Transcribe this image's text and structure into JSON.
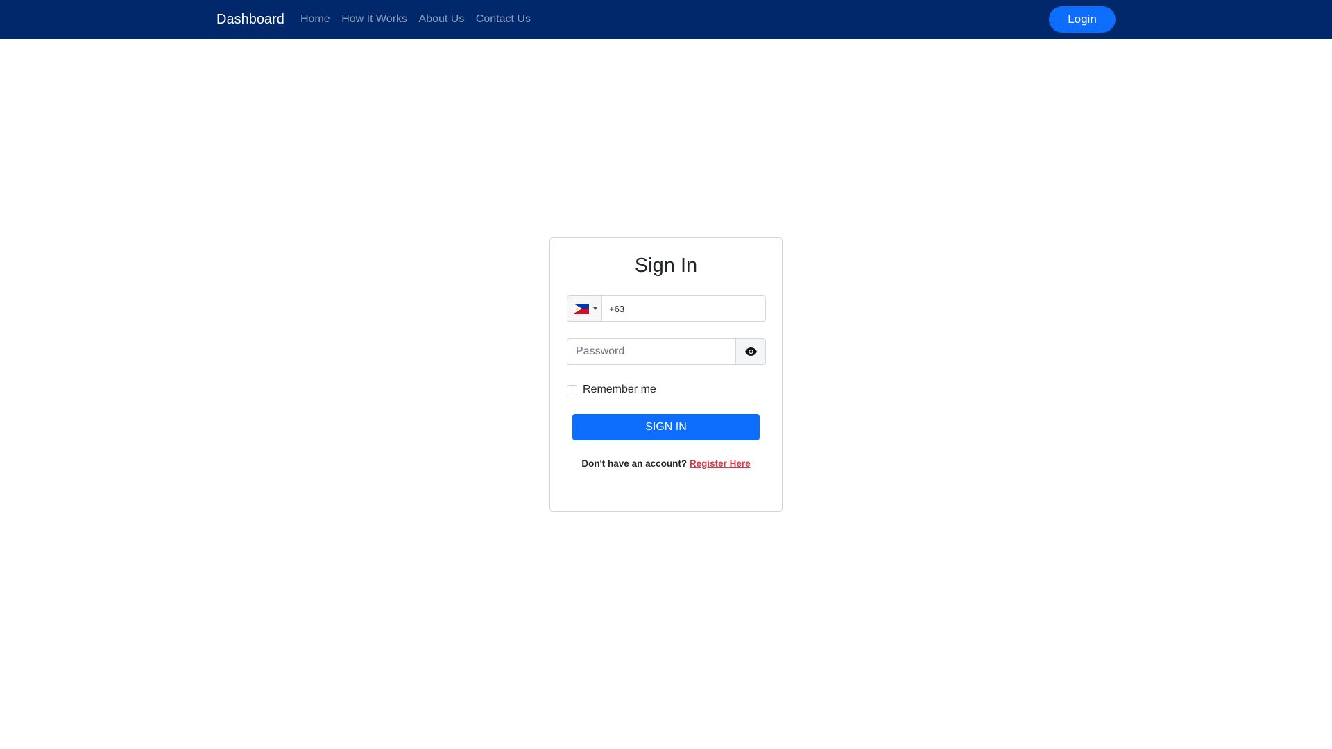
{
  "navbar": {
    "brand": "Dashboard",
    "links": [
      "Home",
      "How It Works",
      "About Us",
      "Contact Us"
    ],
    "login_label": "Login"
  },
  "signin_card": {
    "title": "Sign In",
    "phone": {
      "country_flag": "philippines-flag",
      "value": "+63"
    },
    "password": {
      "placeholder": "Password",
      "toggle_icon": "eye-icon"
    },
    "remember_label": "Remember me",
    "remember_checked": false,
    "submit_label": "SIGN IN",
    "register_prompt": "Don't have an account?",
    "register_link": "Register Here"
  },
  "colors": {
    "navbar_bg": "#02286c",
    "primary": "#0d6efd",
    "link_danger": "#dc3545"
  }
}
